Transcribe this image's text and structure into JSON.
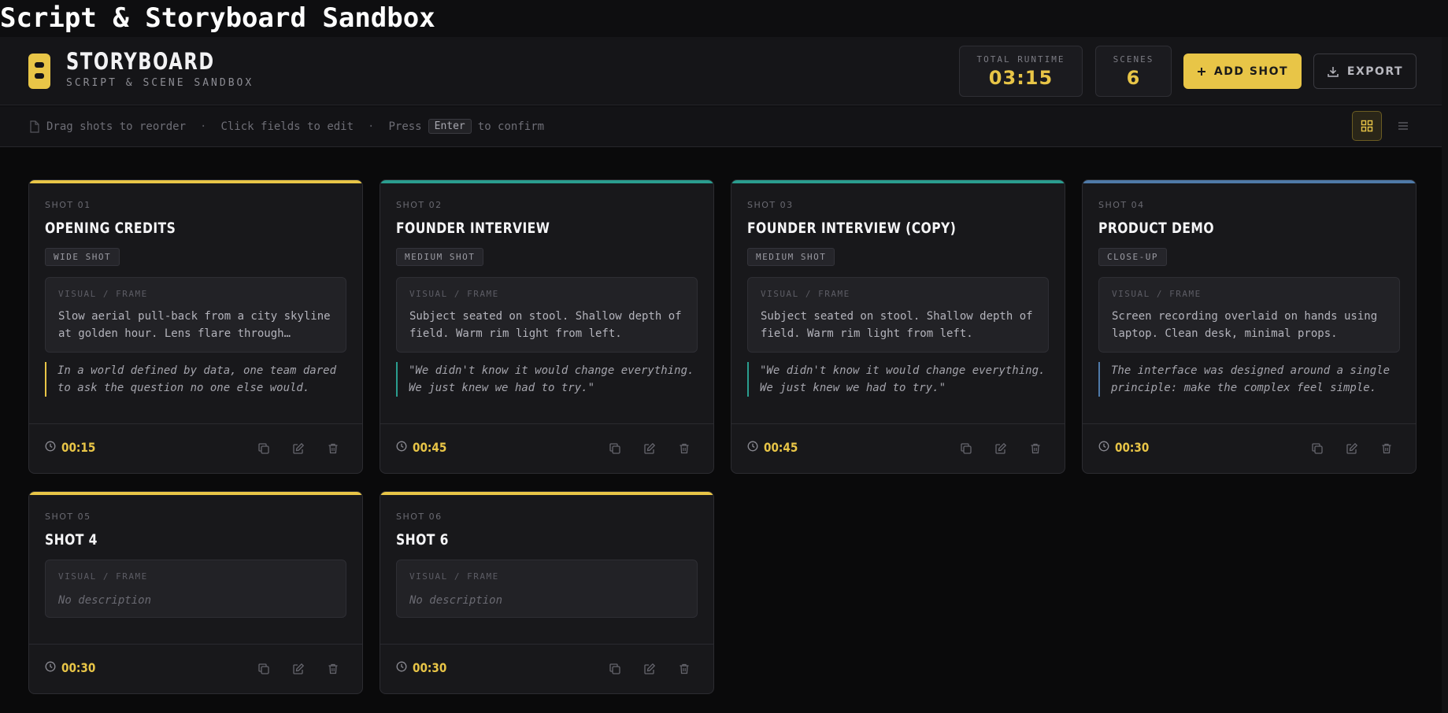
{
  "page_title": "Script & Storyboard Sandbox",
  "brand": {
    "name": "STORYBOARD",
    "subtitle": "SCRIPT & SCENE SANDBOX"
  },
  "stats": {
    "runtime_label": "TOTAL RUNTIME",
    "runtime_value": "03:15",
    "scenes_label": "SCENES",
    "scenes_value": "6"
  },
  "buttons": {
    "add_shot": "ADD SHOT",
    "export": "EXPORT"
  },
  "hints": {
    "drag": "Drag shots to reorder",
    "click": "Click fields to edit",
    "press": "Press",
    "key": "Enter",
    "confirm": "to confirm"
  },
  "visual_label": "VISUAL / FRAME",
  "shots": [
    {
      "num": "SHOT 01",
      "title": "OPENING CREDITS",
      "type": "WIDE SHOT",
      "visual": "Slow aerial pull-back from a city skyline at golden hour. Lens flare through…",
      "quote": "In a world defined by data, one team dared to ask the question no one else would.",
      "duration": "00:15",
      "accent": "#e8c547"
    },
    {
      "num": "SHOT 02",
      "title": "FOUNDER INTERVIEW",
      "type": "MEDIUM SHOT",
      "visual": "Subject seated on stool. Shallow depth of field. Warm rim light from left.",
      "quote": "\"We didn't know it would change everything. We just knew we had to try.\"",
      "duration": "00:45",
      "accent": "#2a9d8f"
    },
    {
      "num": "SHOT 03",
      "title": "FOUNDER INTERVIEW (COPY)",
      "type": "MEDIUM SHOT",
      "visual": "Subject seated on stool. Shallow depth of field. Warm rim light from left.",
      "quote": "\"We didn't know it would change everything. We just knew we had to try.\"",
      "duration": "00:45",
      "accent": "#2a9d8f"
    },
    {
      "num": "SHOT 04",
      "title": "PRODUCT DEMO",
      "type": "CLOSE-UP",
      "visual": "Screen recording overlaid on hands using laptop. Clean desk, minimal props.",
      "quote": "The interface was designed around a single principle: make the complex feel simple.",
      "duration": "00:30",
      "accent": "#4f7aa8"
    },
    {
      "num": "SHOT 05",
      "title": "SHOT 4",
      "type": "",
      "visual": "No description",
      "quote": "",
      "duration": "00:30",
      "accent": "#e8c547"
    },
    {
      "num": "SHOT 06",
      "title": "SHOT 6",
      "type": "",
      "visual": "No description",
      "quote": "",
      "duration": "00:30",
      "accent": "#e8c547"
    }
  ],
  "icons": {
    "logo": "storyboard-logo-icon",
    "add": "plus-icon",
    "export": "download-icon",
    "file": "document-icon",
    "grid": "grid-view-icon",
    "list": "list-view-icon",
    "clock": "clock-icon",
    "duplicate": "duplicate-icon",
    "edit": "edit-icon",
    "delete": "trash-icon"
  }
}
